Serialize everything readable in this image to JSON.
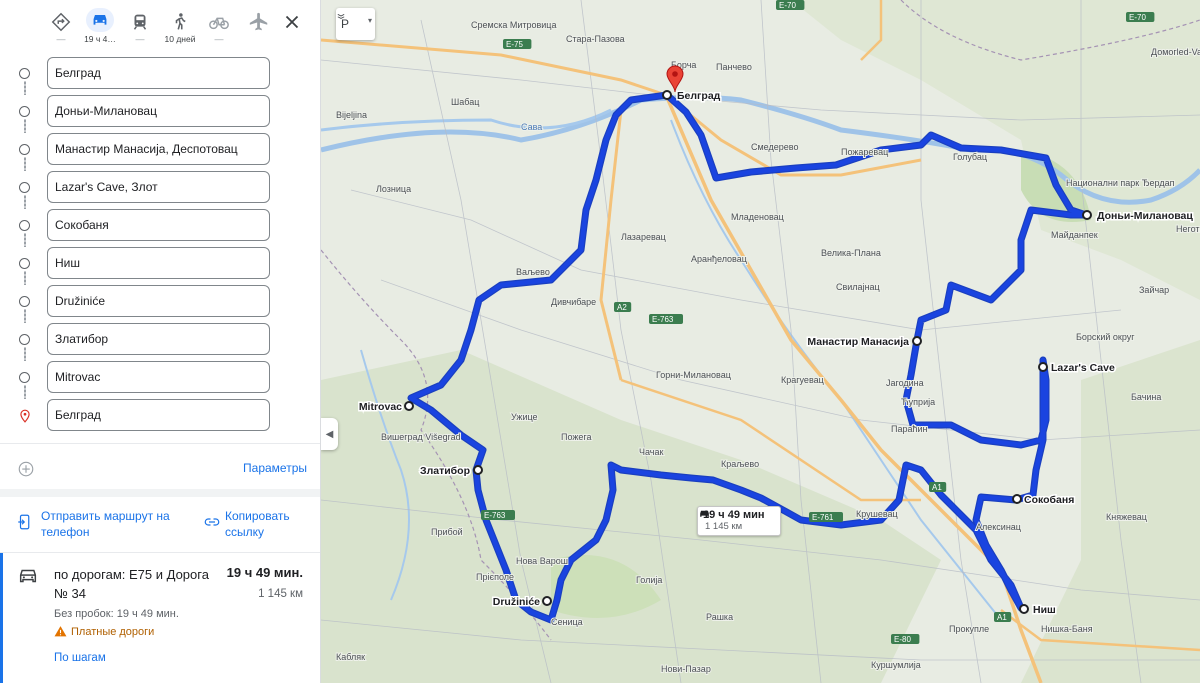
{
  "modes": {
    "best_route": {
      "label": "—"
    },
    "driving": {
      "label": "19 ч 4…"
    },
    "transit": {
      "label": "—"
    },
    "walking": {
      "label": "10 дней"
    },
    "bicycling": {
      "label": "—"
    },
    "flights": {
      "label": "—"
    }
  },
  "waypoints": [
    "Белград",
    "Доньи-Милановац",
    "Манастир Манасија, Деспотовац",
    "Lazar's Cave, Злот",
    "Сокобаня",
    "Ниш",
    "Družiniće",
    "Златибор",
    "Mitrovac",
    "Белград"
  ],
  "params_label": "Параметры",
  "share": {
    "send_to_phone": "Отправить маршрут на телефон",
    "copy_link": "Копировать ссылку"
  },
  "route": {
    "title": "по дорогам: Е75 и Дорога № 34",
    "time": "19 ч 49 мин.",
    "distance": "1 145 км",
    "no_traffic": "Без пробок: 19 ч 49 мин.",
    "toll": "Платные дороги",
    "steps": "По шагам"
  },
  "map": {
    "layer_button": "Р",
    "callout": {
      "time": "19 ч 49 мин",
      "distance": "1 145 км"
    },
    "route_color": "#1a44e0",
    "stops": [
      "Белград",
      "Доньи-Милановац",
      "Манастир Манасија",
      "Lazar's Cave",
      "Сокобаня",
      "Ниш",
      "Družiniće",
      "Златибор",
      "Mitrovac"
    ],
    "places": [
      "Сремска Митровица",
      "Стара-Пазова",
      "Борча",
      "Панчево",
      "Шабац",
      "Bijeljina",
      "Сава",
      "Смедерево",
      "Пожаревац",
      "Голубац",
      "Национални парк Ђердап",
      "Лозница",
      "Младеновац",
      "Лазаревац",
      "Ваљево",
      "Аранђеловац",
      "Велика-Плана",
      "Свилајнац",
      "Майданпек",
      "Дивчибаре",
      "Горни-Милановац",
      "Крагуевац",
      "Јагодина",
      "Ћуприја",
      "Параћин",
      "Ужице",
      "Пожега",
      "Чачак",
      "Краљево",
      "Крушевац",
      "Алексинац",
      "Вишеград Višegrad",
      "Прибой",
      "Нова Варош",
      "Голија",
      "Прієполе",
      "Сеница",
      "Рашка",
      "Прокупле",
      "Нишка-Баня",
      "Куршумлија",
      "Нови-Пазар",
      "Кабляк",
      "Зайчар",
      "Борский округ",
      "Княжевац",
      "Неготин",
      "Домогled-Valea Cernei",
      "Бачина"
    ],
    "roads": [
      "E-70",
      "E-70",
      "E-75",
      "A2",
      "E-763",
      "E-763",
      "E-761",
      "A1",
      "E-80",
      "A1"
    ]
  }
}
